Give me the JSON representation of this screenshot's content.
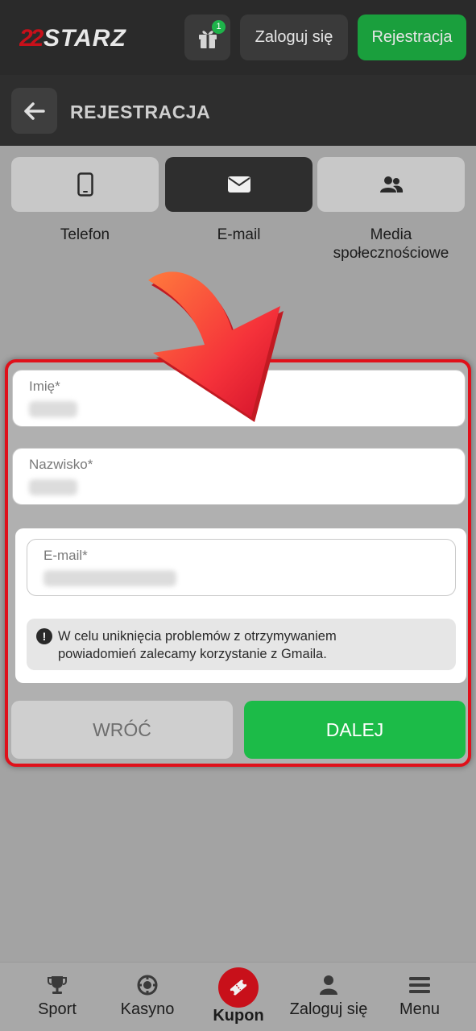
{
  "header": {
    "logo_text": "22STARZ",
    "gift_badge": "1",
    "login_label": "Zaloguj się",
    "register_label": "Rejestracja"
  },
  "subheader": {
    "title": "REJESTRACJA"
  },
  "tabs": [
    {
      "label": "Telefon",
      "icon": "phone-icon",
      "selected": false
    },
    {
      "label": "E-mail",
      "icon": "envelope-icon",
      "selected": true
    },
    {
      "label_line1": "Media",
      "label_line2": "społecznościowe",
      "icon": "users-icon",
      "selected": false
    }
  ],
  "form": {
    "first_name_label": "Imię*",
    "last_name_label": "Nazwisko*",
    "email_label": "E-mail*",
    "info_line1": "W celu uniknięcia problemów z otrzymywaniem",
    "info_line2": "powiadomień zalecamy korzystanie z Gmaila.",
    "back_label": "WRÓĆ",
    "next_label": "DALEJ"
  },
  "bottom_nav": {
    "items": [
      {
        "label": "Sport",
        "icon": "trophy-icon"
      },
      {
        "label": "Kasyno",
        "icon": "casino-chip-icon"
      },
      {
        "label": "Kupon",
        "icon": "ticket-icon",
        "active": true
      },
      {
        "label": "Zaloguj się",
        "icon": "user-icon"
      },
      {
        "label": "Menu",
        "icon": "hamburger-icon"
      }
    ]
  },
  "colors": {
    "accent_green": "#1cbb48",
    "highlight_red": "#e0101a",
    "header_dark": "#2a2a2a"
  }
}
